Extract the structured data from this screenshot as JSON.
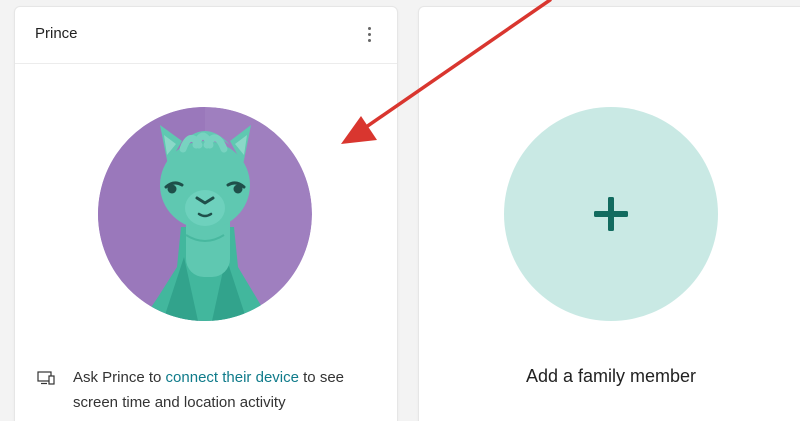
{
  "member_card": {
    "name": "Prince",
    "more_icon": "more-vertical-icon",
    "avatar_icon": "llama-avatar-icon",
    "device_icon": "device-screen-icon",
    "device_prompt": {
      "prefix": "Ask Prince to ",
      "link": "connect their device",
      "suffix": " to see screen time and location activity"
    }
  },
  "add_card": {
    "plus_icon": "plus-icon",
    "label": "Add a family member"
  },
  "annotation": {
    "arrow_icon": "red-arrow-icon",
    "color": "#d9362f"
  },
  "colors": {
    "accent_link": "#0f7b8a",
    "add_circle": "#c9e9e4",
    "plus": "#126b5f",
    "avatar_bg": "#9f7fbf",
    "llama": "#5fc8b1"
  }
}
